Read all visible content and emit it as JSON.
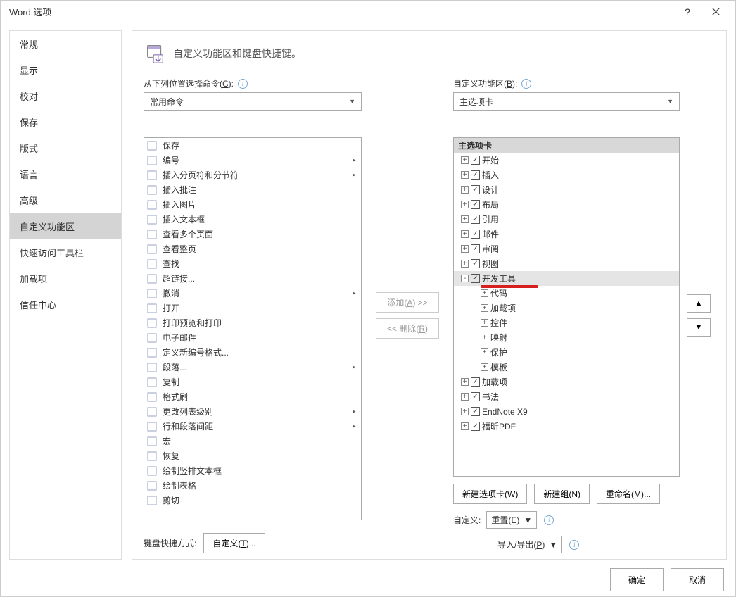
{
  "window": {
    "title": "Word 选项"
  },
  "sidebar": {
    "items": [
      {
        "label": "常规"
      },
      {
        "label": "显示"
      },
      {
        "label": "校对"
      },
      {
        "label": "保存"
      },
      {
        "label": "版式"
      },
      {
        "label": "语言"
      },
      {
        "label": "高级"
      },
      {
        "label": "自定义功能区",
        "selected": true
      },
      {
        "label": "快速访问工具栏"
      },
      {
        "label": "加载项"
      },
      {
        "label": "信任中心"
      }
    ]
  },
  "header": {
    "text": "自定义功能区和键盘快捷键。"
  },
  "left": {
    "label_pre": "从下列位置选择命令(",
    "label_u": "C",
    "label_post": "):",
    "combo": "常用命令",
    "commands": [
      {
        "label": "保存"
      },
      {
        "label": "编号",
        "fly": true
      },
      {
        "label": "插入分页符和分节符",
        "fly": true
      },
      {
        "label": "插入批注"
      },
      {
        "label": "插入图片"
      },
      {
        "label": "插入文本框"
      },
      {
        "label": "查看多个页面"
      },
      {
        "label": "查看整页"
      },
      {
        "label": "查找"
      },
      {
        "label": "超链接..."
      },
      {
        "label": "撤消",
        "fly": true
      },
      {
        "label": "打开"
      },
      {
        "label": "打印预览和打印"
      },
      {
        "label": "电子邮件"
      },
      {
        "label": "定义新编号格式..."
      },
      {
        "label": "段落...",
        "fly": true
      },
      {
        "label": "复制"
      },
      {
        "label": "格式刷"
      },
      {
        "label": "更改列表级别",
        "fly": true
      },
      {
        "label": "行和段落间距",
        "fly": true
      },
      {
        "label": "宏"
      },
      {
        "label": "恢复"
      },
      {
        "label": "绘制竖排文本框"
      },
      {
        "label": "绘制表格"
      },
      {
        "label": "剪切"
      }
    ],
    "kb_label": "键盘快捷方式:",
    "kb_btn_pre": "自定义(",
    "kb_btn_u": "T",
    "kb_btn_post": ")..."
  },
  "mid": {
    "add_pre": "添加(",
    "add_u": "A",
    "add_post": ") >>",
    "remove_pre": "<< 删除(",
    "remove_u": "R",
    "remove_post": ")"
  },
  "right": {
    "label_pre": "自定义功能区(",
    "label_u": "B",
    "label_post": "):",
    "combo": "主选项卡",
    "tree_header": "主选项卡",
    "tree": [
      {
        "label": "开始",
        "level": 1,
        "exp": "+",
        "cb": true
      },
      {
        "label": "插入",
        "level": 1,
        "exp": "+",
        "cb": true
      },
      {
        "label": "设计",
        "level": 1,
        "exp": "+",
        "cb": true
      },
      {
        "label": "布局",
        "level": 1,
        "exp": "+",
        "cb": true
      },
      {
        "label": "引用",
        "level": 1,
        "exp": "+",
        "cb": true
      },
      {
        "label": "邮件",
        "level": 1,
        "exp": "+",
        "cb": true
      },
      {
        "label": "审阅",
        "level": 1,
        "exp": "+",
        "cb": true
      },
      {
        "label": "视图",
        "level": 1,
        "exp": "+",
        "cb": true
      },
      {
        "label": "开发工具",
        "level": 1,
        "exp": "-",
        "cb": true,
        "highlight": true,
        "redline": true
      },
      {
        "label": "代码",
        "level": 2,
        "exp": "+"
      },
      {
        "label": "加载项",
        "level": 2,
        "exp": "+"
      },
      {
        "label": "控件",
        "level": 2,
        "exp": "+"
      },
      {
        "label": "映射",
        "level": 2,
        "exp": "+"
      },
      {
        "label": "保护",
        "level": 2,
        "exp": "+"
      },
      {
        "label": "模板",
        "level": 2,
        "exp": "+"
      },
      {
        "label": "加载项",
        "level": 1,
        "exp": "+",
        "cb": true
      },
      {
        "label": "书法",
        "level": 1,
        "exp": "+",
        "cb": true
      },
      {
        "label": "EndNote X9",
        "level": 1,
        "exp": "+",
        "cb": true
      },
      {
        "label": "福昕PDF",
        "level": 1,
        "exp": "+",
        "cb": true
      }
    ],
    "new_tab_pre": "新建选项卡(",
    "new_tab_u": "W",
    "new_tab_post": ")",
    "new_group_pre": "新建组(",
    "new_group_u": "N",
    "new_group_post": ")",
    "rename_pre": "重命名(",
    "rename_u": "M",
    "rename_post": ")...",
    "custom_label": "自定义:",
    "reset_pre": "重置(",
    "reset_u": "E",
    "reset_post": ")",
    "import_pre": "导入/导出(",
    "import_u": "P",
    "import_post": ")"
  },
  "footer": {
    "ok": "确定",
    "cancel": "取消"
  }
}
